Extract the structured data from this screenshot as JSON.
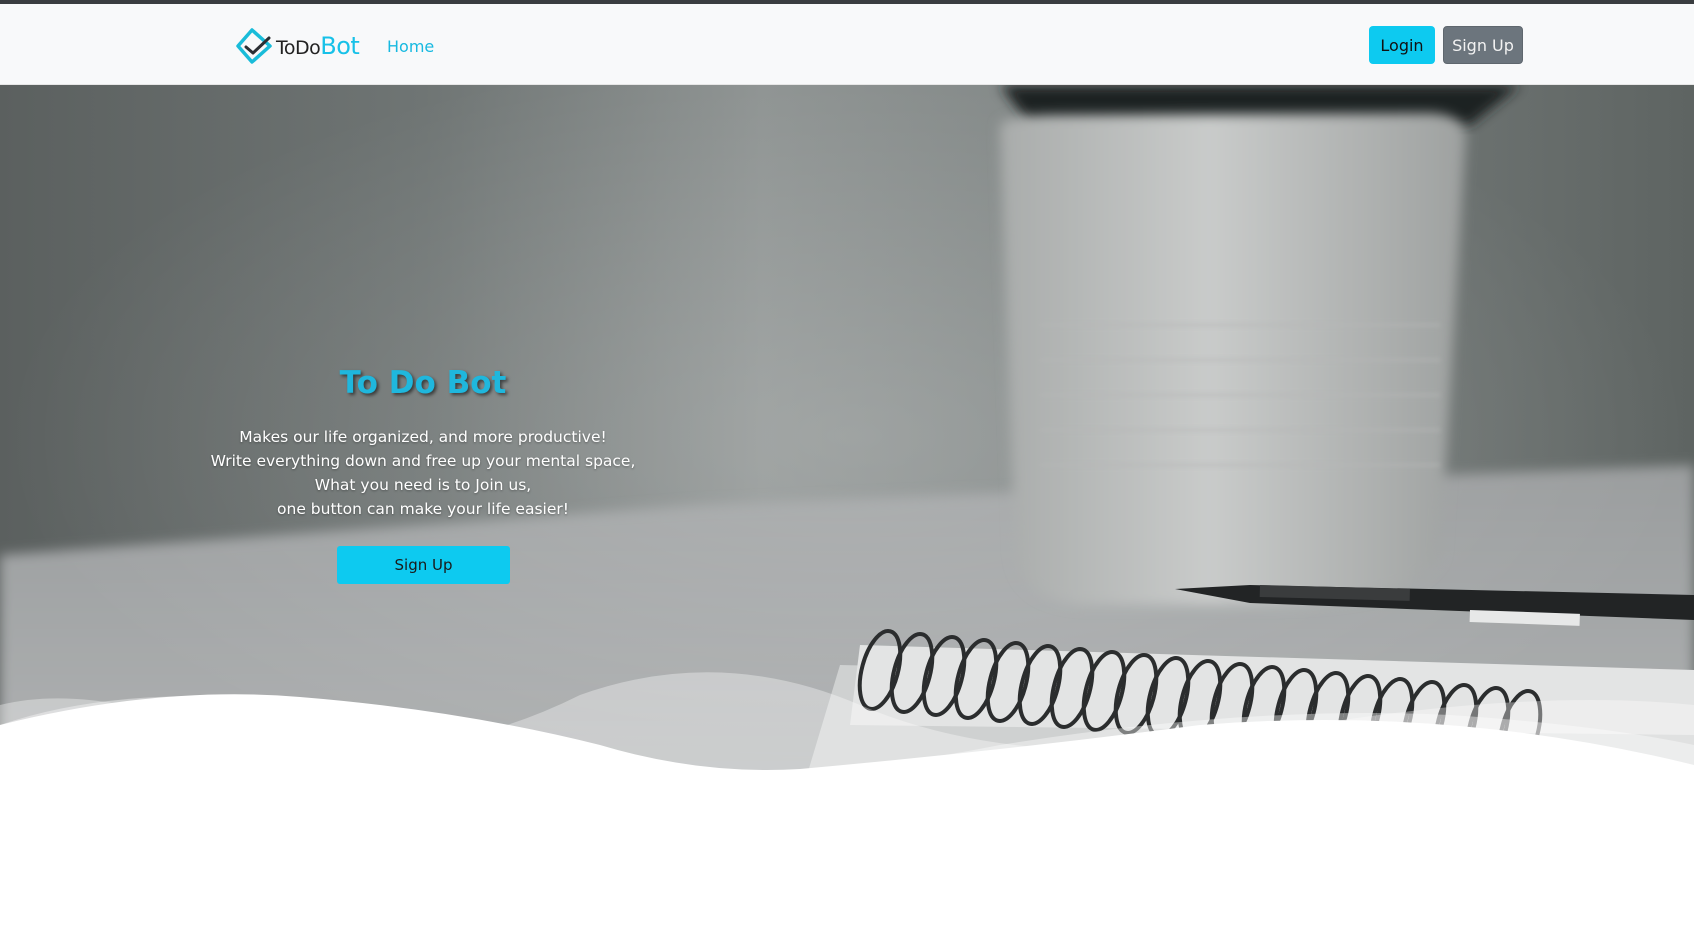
{
  "navbar": {
    "brand_todo": "ToDo",
    "brand_bot": "Bot",
    "home_link": "Home",
    "login_label": "Login",
    "signup_label": "Sign Up"
  },
  "hero": {
    "title": "To Do Bot",
    "lines": [
      "Makes our life organized, and more productive!",
      "Write everything down and free up your mental space,",
      "What you need is to Join us,",
      "one button can make your life easier!"
    ],
    "cta_label": "Sign Up"
  },
  "colors": {
    "accent": "#0dcaf0",
    "secondary": "#6c757d",
    "title": "#1fb7dd",
    "navbar_bg": "#f8f9fa"
  },
  "icons": {
    "brand_logo": "todobot-diamond-check-icon"
  }
}
